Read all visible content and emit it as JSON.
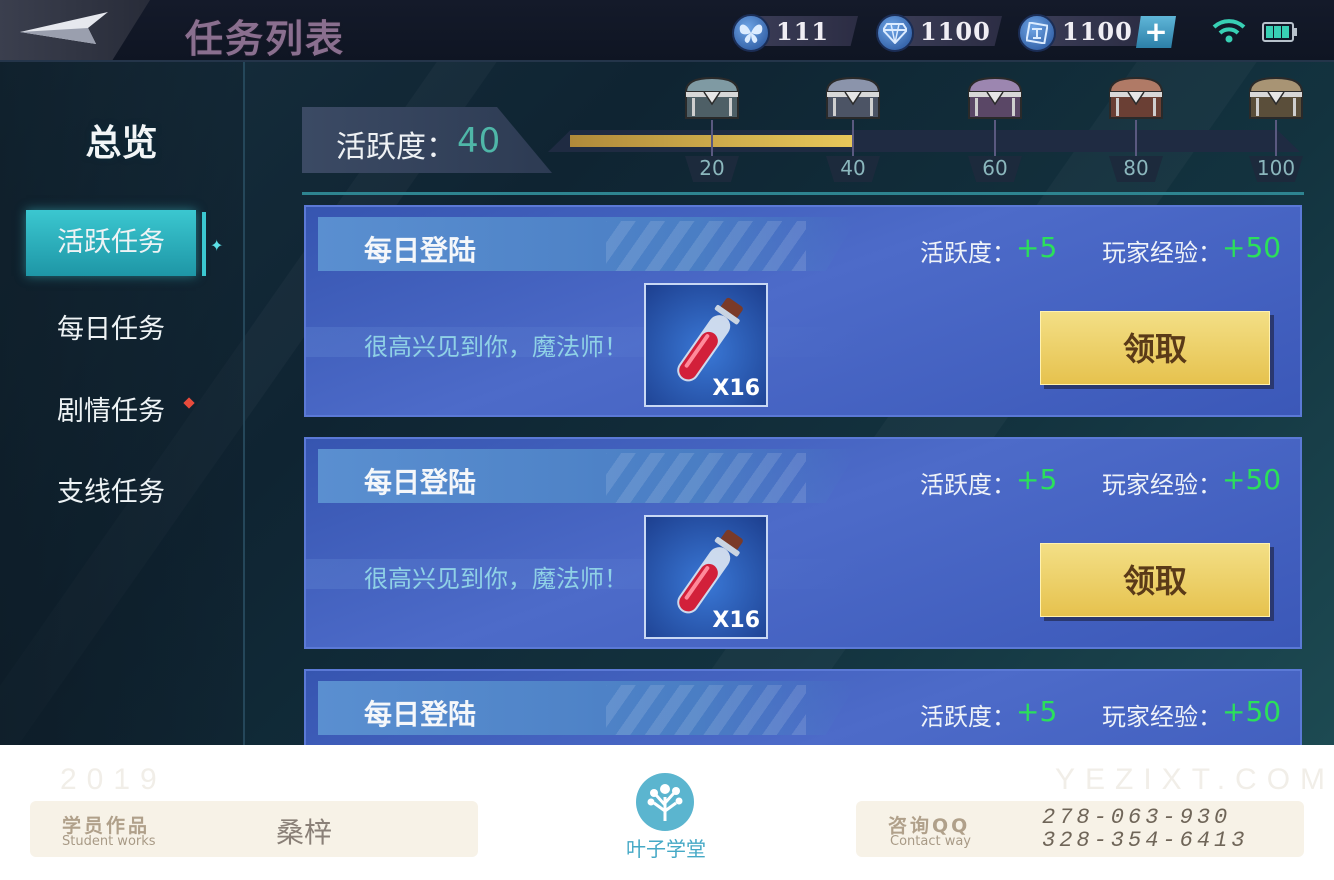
{
  "header": {
    "title": "任务列表",
    "resources": [
      {
        "icon": "butterfly-icon",
        "value": "111"
      },
      {
        "icon": "diamond-icon",
        "value": "1100"
      },
      {
        "icon": "rune-coin-icon",
        "value": "1100"
      }
    ]
  },
  "sidebar": {
    "title": "总览",
    "items": [
      {
        "label": "活跃任务",
        "active": true
      },
      {
        "label": "每日任务"
      },
      {
        "label": "剧情任务",
        "badge": true
      },
      {
        "label": "支线任务"
      }
    ]
  },
  "activity": {
    "label": "活跃度：",
    "value": "40",
    "progress": 40,
    "max": 100,
    "milestones": [
      "20",
      "40",
      "60",
      "80",
      "100"
    ]
  },
  "tasks": [
    {
      "title": "每日登陆",
      "activity_label": "活跃度：",
      "activity_value": "+5",
      "exp_label": "玩家经验：",
      "exp_value": "+50",
      "description": "很高兴见到你，魔法师！",
      "item_qty": "X16",
      "button": "领取"
    },
    {
      "title": "每日登陆",
      "activity_label": "活跃度：",
      "activity_value": "+5",
      "exp_label": "玩家经验：",
      "exp_value": "+50",
      "description": "很高兴见到你，魔法师！",
      "item_qty": "X16",
      "button": "领取"
    },
    {
      "title": "每日登陆",
      "activity_label": "活跃度：",
      "activity_value": "+5",
      "exp_label": "玩家经验：",
      "exp_value": "+50"
    }
  ],
  "footer": {
    "year": "2019",
    "site": "YEZIXT.COM",
    "student_cn": "学员作品",
    "student_en": "Student works",
    "student_name": "桑梓",
    "logo_text": "叶子学堂",
    "contact_cn": "咨询QQ",
    "contact_en": "Contact way",
    "qq1": "278-063-930",
    "qq2": "328-354-6413"
  },
  "colors": {
    "accent": "#3bc7d0",
    "reward_green": "#2be05a",
    "claim_gold": "#e6c24e",
    "card_blue": "#4d6bc9"
  }
}
